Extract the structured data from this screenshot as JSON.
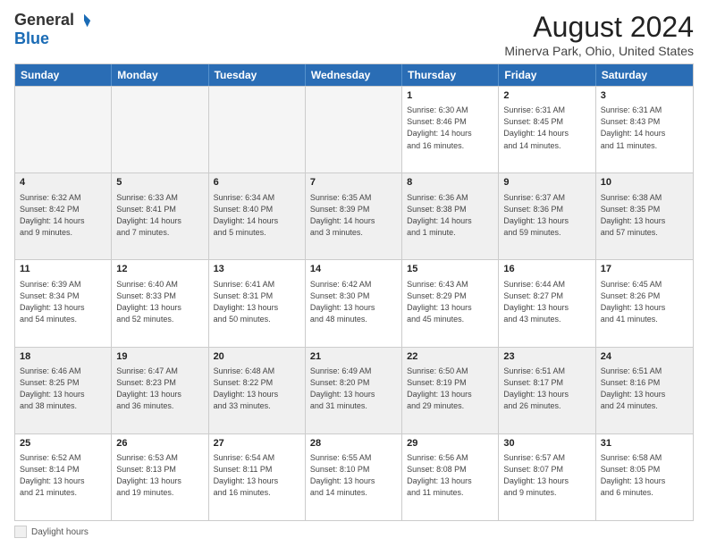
{
  "logo": {
    "general": "General",
    "blue": "Blue"
  },
  "header": {
    "title": "August 2024",
    "location": "Minerva Park, Ohio, United States"
  },
  "days": [
    "Sunday",
    "Monday",
    "Tuesday",
    "Wednesday",
    "Thursday",
    "Friday",
    "Saturday"
  ],
  "footer": {
    "legend_label": "Daylight hours"
  },
  "rows": [
    [
      {
        "day": "",
        "info": "",
        "empty": true
      },
      {
        "day": "",
        "info": "",
        "empty": true
      },
      {
        "day": "",
        "info": "",
        "empty": true
      },
      {
        "day": "",
        "info": "",
        "empty": true
      },
      {
        "day": "1",
        "info": "Sunrise: 6:30 AM\nSunset: 8:46 PM\nDaylight: 14 hours\nand 16 minutes."
      },
      {
        "day": "2",
        "info": "Sunrise: 6:31 AM\nSunset: 8:45 PM\nDaylight: 14 hours\nand 14 minutes."
      },
      {
        "day": "3",
        "info": "Sunrise: 6:31 AM\nSunset: 8:43 PM\nDaylight: 14 hours\nand 11 minutes."
      }
    ],
    [
      {
        "day": "4",
        "info": "Sunrise: 6:32 AM\nSunset: 8:42 PM\nDaylight: 14 hours\nand 9 minutes."
      },
      {
        "day": "5",
        "info": "Sunrise: 6:33 AM\nSunset: 8:41 PM\nDaylight: 14 hours\nand 7 minutes."
      },
      {
        "day": "6",
        "info": "Sunrise: 6:34 AM\nSunset: 8:40 PM\nDaylight: 14 hours\nand 5 minutes."
      },
      {
        "day": "7",
        "info": "Sunrise: 6:35 AM\nSunset: 8:39 PM\nDaylight: 14 hours\nand 3 minutes."
      },
      {
        "day": "8",
        "info": "Sunrise: 6:36 AM\nSunset: 8:38 PM\nDaylight: 14 hours\nand 1 minute."
      },
      {
        "day": "9",
        "info": "Sunrise: 6:37 AM\nSunset: 8:36 PM\nDaylight: 13 hours\nand 59 minutes."
      },
      {
        "day": "10",
        "info": "Sunrise: 6:38 AM\nSunset: 8:35 PM\nDaylight: 13 hours\nand 57 minutes."
      }
    ],
    [
      {
        "day": "11",
        "info": "Sunrise: 6:39 AM\nSunset: 8:34 PM\nDaylight: 13 hours\nand 54 minutes."
      },
      {
        "day": "12",
        "info": "Sunrise: 6:40 AM\nSunset: 8:33 PM\nDaylight: 13 hours\nand 52 minutes."
      },
      {
        "day": "13",
        "info": "Sunrise: 6:41 AM\nSunset: 8:31 PM\nDaylight: 13 hours\nand 50 minutes."
      },
      {
        "day": "14",
        "info": "Sunrise: 6:42 AM\nSunset: 8:30 PM\nDaylight: 13 hours\nand 48 minutes."
      },
      {
        "day": "15",
        "info": "Sunrise: 6:43 AM\nSunset: 8:29 PM\nDaylight: 13 hours\nand 45 minutes."
      },
      {
        "day": "16",
        "info": "Sunrise: 6:44 AM\nSunset: 8:27 PM\nDaylight: 13 hours\nand 43 minutes."
      },
      {
        "day": "17",
        "info": "Sunrise: 6:45 AM\nSunset: 8:26 PM\nDaylight: 13 hours\nand 41 minutes."
      }
    ],
    [
      {
        "day": "18",
        "info": "Sunrise: 6:46 AM\nSunset: 8:25 PM\nDaylight: 13 hours\nand 38 minutes."
      },
      {
        "day": "19",
        "info": "Sunrise: 6:47 AM\nSunset: 8:23 PM\nDaylight: 13 hours\nand 36 minutes."
      },
      {
        "day": "20",
        "info": "Sunrise: 6:48 AM\nSunset: 8:22 PM\nDaylight: 13 hours\nand 33 minutes."
      },
      {
        "day": "21",
        "info": "Sunrise: 6:49 AM\nSunset: 8:20 PM\nDaylight: 13 hours\nand 31 minutes."
      },
      {
        "day": "22",
        "info": "Sunrise: 6:50 AM\nSunset: 8:19 PM\nDaylight: 13 hours\nand 29 minutes."
      },
      {
        "day": "23",
        "info": "Sunrise: 6:51 AM\nSunset: 8:17 PM\nDaylight: 13 hours\nand 26 minutes."
      },
      {
        "day": "24",
        "info": "Sunrise: 6:51 AM\nSunset: 8:16 PM\nDaylight: 13 hours\nand 24 minutes."
      }
    ],
    [
      {
        "day": "25",
        "info": "Sunrise: 6:52 AM\nSunset: 8:14 PM\nDaylight: 13 hours\nand 21 minutes."
      },
      {
        "day": "26",
        "info": "Sunrise: 6:53 AM\nSunset: 8:13 PM\nDaylight: 13 hours\nand 19 minutes."
      },
      {
        "day": "27",
        "info": "Sunrise: 6:54 AM\nSunset: 8:11 PM\nDaylight: 13 hours\nand 16 minutes."
      },
      {
        "day": "28",
        "info": "Sunrise: 6:55 AM\nSunset: 8:10 PM\nDaylight: 13 hours\nand 14 minutes."
      },
      {
        "day": "29",
        "info": "Sunrise: 6:56 AM\nSunset: 8:08 PM\nDaylight: 13 hours\nand 11 minutes."
      },
      {
        "day": "30",
        "info": "Sunrise: 6:57 AM\nSunset: 8:07 PM\nDaylight: 13 hours\nand 9 minutes."
      },
      {
        "day": "31",
        "info": "Sunrise: 6:58 AM\nSunset: 8:05 PM\nDaylight: 13 hours\nand 6 minutes."
      }
    ]
  ]
}
